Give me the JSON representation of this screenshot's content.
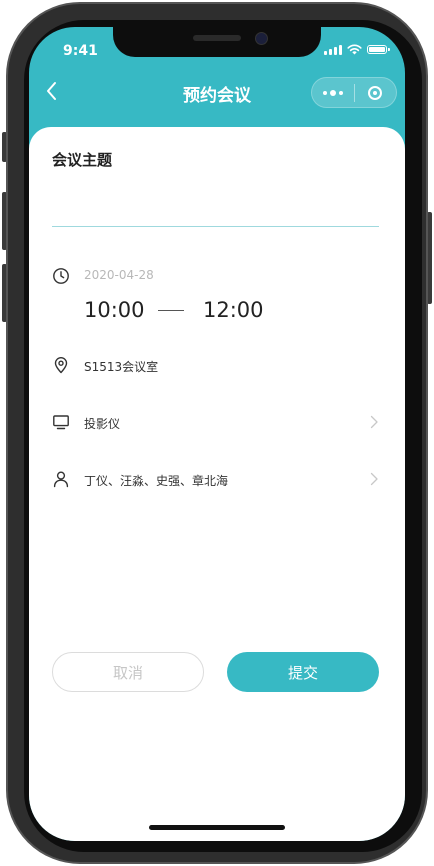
{
  "status_bar": {
    "time": "9:41"
  },
  "nav": {
    "title": "预约会议",
    "back_icon": "chevron-left-icon",
    "more_icon": "more-dots-icon",
    "close_icon": "target-close-icon"
  },
  "form": {
    "subject_label": "会议主题",
    "subject_value": "",
    "subject_placeholder": "",
    "date": "2020-04-28",
    "start_time": "10:00",
    "end_time": "12:00",
    "room": "S1513会议室",
    "equipment": "投影仪",
    "attendees": "丁仪、汪淼、史强、章北海"
  },
  "buttons": {
    "cancel": "取消",
    "submit": "提交"
  },
  "colors": {
    "accent": "#37b9c4",
    "divider": "#9fd9de",
    "muted_text": "#b8b8b8"
  }
}
